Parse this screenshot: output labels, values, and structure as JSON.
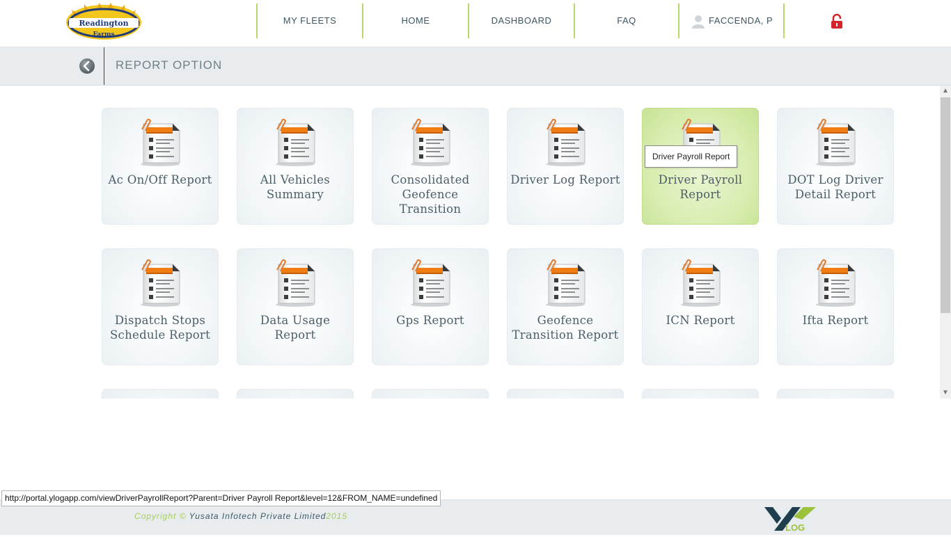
{
  "header": {
    "logo_text_top": "Readington",
    "logo_text_bottom": "Farms",
    "nav": {
      "my_fleets": "MY FLEETS",
      "home": "HOME",
      "dashboard": "DASHBOARD",
      "faq": "FAQ",
      "user": "FACCENDA, P"
    },
    "icons": {
      "user": "user-icon",
      "logout": "lock-icon"
    }
  },
  "subheader": {
    "title": "REPORT OPTION",
    "back_icon": "chevron-left-icon"
  },
  "reports": [
    {
      "label": "Ac On/Off Report"
    },
    {
      "label": "All Vehicles Summary"
    },
    {
      "label": "Consolidated Geofence Transition"
    },
    {
      "label": "Driver Log Report"
    },
    {
      "label": "Driver Payroll Report"
    },
    {
      "label": "DOT Log Driver Detail Report"
    },
    {
      "label": "Dispatch Stops Schedule Report"
    },
    {
      "label": "Data Usage Report"
    },
    {
      "label": "Gps Report"
    },
    {
      "label": "Geofence Transition Report"
    },
    {
      "label": "ICN Report"
    },
    {
      "label": "Ifta Report"
    }
  ],
  "tooltip": "Driver Payroll Report",
  "status_url": "http://portal.ylogapp.com/viewDriverPayrollReport?Parent=Driver Payroll Report&level=12&FROM_NAME=undefined",
  "footer": {
    "copyright_prefix": "Copyright © ",
    "company": "Yusata Infotech Private Limited",
    "year": "2015",
    "logo_text": "LOG"
  },
  "colors": {
    "accent_green": "#b8d56f",
    "hover_tile": "#d8edb0",
    "nav_text": "#3c5560",
    "logout_red": "#d6232a"
  }
}
